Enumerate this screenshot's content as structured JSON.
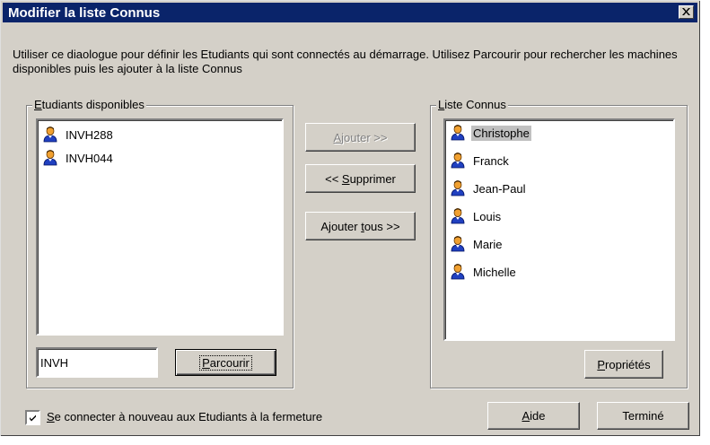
{
  "dialog": {
    "title": "Modifier la liste Connus",
    "description": "Utiliser ce diaologue pour définir les Etudiants qui sont connectés au démarrage. Utilisez Parcourir pour rechercher les machines disponibles puis les ajouter à la liste Connus"
  },
  "available": {
    "legend_u": "E",
    "legend_rest": "tudiants disponibles",
    "items": [
      "INVH288",
      "INVH044"
    ],
    "filter_value": "INVH",
    "browse_u": "P",
    "browse_rest": "arcourir"
  },
  "middle": {
    "add_u": "A",
    "add_rest": "jouter >>",
    "remove_pre": "<< ",
    "remove_u": "S",
    "remove_rest": "upprimer",
    "addall_pre": "Ajouter ",
    "addall_u": "t",
    "addall_rest": "ous >>"
  },
  "known": {
    "legend_u": "L",
    "legend_rest": "iste Connus",
    "items": [
      "Christophe",
      "Franck",
      "Jean-Paul",
      "Louis",
      "Marie",
      "Michelle"
    ],
    "selected_index": 0,
    "props_u": "P",
    "props_rest": "ropriétés"
  },
  "footer": {
    "checkbox_checked": true,
    "checkbox_u": "S",
    "checkbox_rest": "e connecter à nouveau aux Etudiants à la fermeture",
    "help_u": "A",
    "help_rest": "ide",
    "done_label": "Terminé"
  },
  "icons": {
    "list_item": "user-icon",
    "close": "close-icon"
  },
  "colors": {
    "titlebar": "#0a246a",
    "face": "#d4d0c8",
    "selection": "#c0c0c0"
  }
}
